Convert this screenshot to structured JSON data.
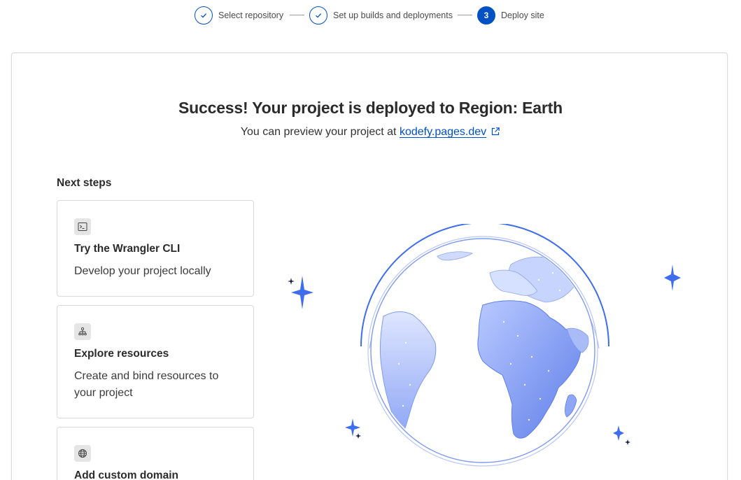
{
  "stepper": {
    "steps": [
      {
        "label": "Select repository",
        "state": "complete"
      },
      {
        "label": "Set up builds and deployments",
        "state": "complete"
      },
      {
        "label": "Deploy site",
        "state": "active",
        "number": "3"
      }
    ]
  },
  "main": {
    "title": "Success! Your project is deployed to Region: Earth",
    "preview_prefix": "You can preview your project at",
    "preview_link": "kodefy.pages.dev",
    "next_steps_heading": "Next steps",
    "cards": [
      {
        "icon": "terminal-icon",
        "title": "Try the Wrangler CLI",
        "description": "Develop your project locally"
      },
      {
        "icon": "sitemap-icon",
        "title": "Explore resources",
        "description": "Create and bind resources to your project"
      },
      {
        "icon": "globe-icon",
        "title": "Add custom domain",
        "description": ""
      }
    ]
  },
  "illustration": {
    "name": "globe-illustration"
  },
  "colors": {
    "accent": "#0051c3",
    "globe_light": "#c9d6ff",
    "globe_mid": "#7f9bf3",
    "sparkle": "#3f6df0",
    "sparkle_dark": "#1b1f4a"
  }
}
